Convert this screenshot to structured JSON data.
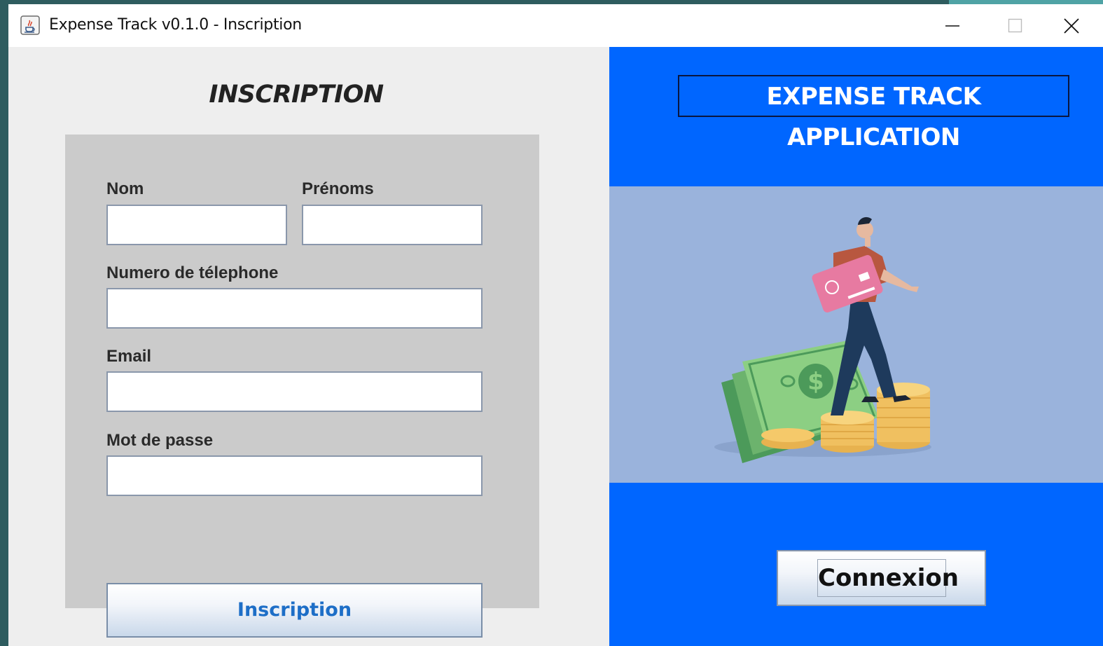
{
  "window": {
    "title": "Expense Track v0.1.0 - Inscription"
  },
  "icons": {
    "app": "java-cup-icon",
    "minimize": "minimize-icon",
    "maximize": "maximize-icon",
    "close": "close-icon"
  },
  "form": {
    "title": "INSCRIPTION",
    "nom_label": "Nom",
    "prenoms_label": "Prénoms",
    "telephone_label": "Numero de télephone",
    "email_label": "Email",
    "password_label": "Mot de passe",
    "nom_value": "",
    "prenoms_value": "",
    "telephone_value": "",
    "email_value": "",
    "password_value": "",
    "submit_label": "Inscription"
  },
  "side": {
    "brand": "EXPENSE TRACK APPLICATION",
    "connect_label": "Connexion"
  },
  "colors": {
    "accent_blue": "#0066ff",
    "illustration_bg": "#9ab3dc",
    "form_panel": "#cbcbcb",
    "button_text": "#1d6ec7"
  }
}
